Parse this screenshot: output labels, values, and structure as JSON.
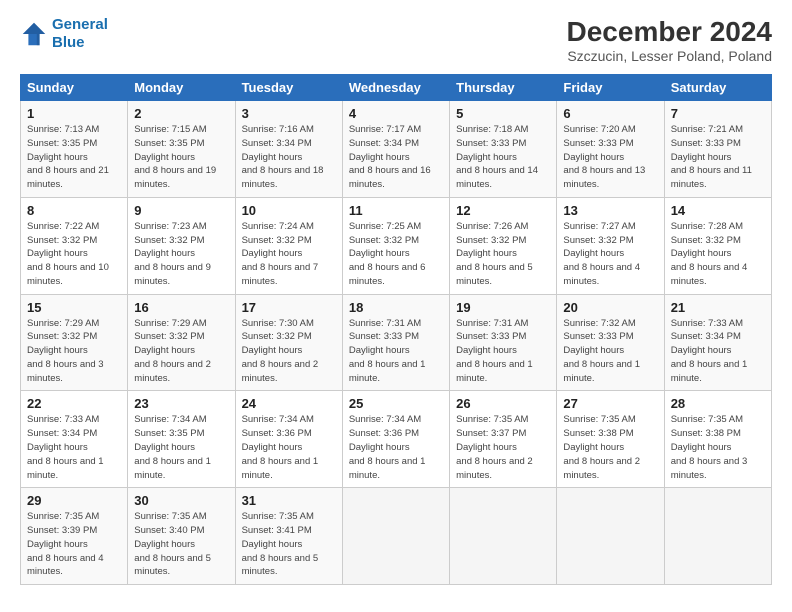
{
  "header": {
    "logo_line1": "General",
    "logo_line2": "Blue",
    "title": "December 2024",
    "subtitle": "Szczucin, Lesser Poland, Poland"
  },
  "calendar": {
    "days_of_week": [
      "Sunday",
      "Monday",
      "Tuesday",
      "Wednesday",
      "Thursday",
      "Friday",
      "Saturday"
    ],
    "weeks": [
      [
        {
          "day": 1,
          "sunrise": "7:13 AM",
          "sunset": "3:35 PM",
          "daylight": "8 hours and 21 minutes."
        },
        {
          "day": 2,
          "sunrise": "7:15 AM",
          "sunset": "3:35 PM",
          "daylight": "8 hours and 19 minutes."
        },
        {
          "day": 3,
          "sunrise": "7:16 AM",
          "sunset": "3:34 PM",
          "daylight": "8 hours and 18 minutes."
        },
        {
          "day": 4,
          "sunrise": "7:17 AM",
          "sunset": "3:34 PM",
          "daylight": "8 hours and 16 minutes."
        },
        {
          "day": 5,
          "sunrise": "7:18 AM",
          "sunset": "3:33 PM",
          "daylight": "8 hours and 14 minutes."
        },
        {
          "day": 6,
          "sunrise": "7:20 AM",
          "sunset": "3:33 PM",
          "daylight": "8 hours and 13 minutes."
        },
        {
          "day": 7,
          "sunrise": "7:21 AM",
          "sunset": "3:33 PM",
          "daylight": "8 hours and 11 minutes."
        }
      ],
      [
        {
          "day": 8,
          "sunrise": "7:22 AM",
          "sunset": "3:32 PM",
          "daylight": "8 hours and 10 minutes."
        },
        {
          "day": 9,
          "sunrise": "7:23 AM",
          "sunset": "3:32 PM",
          "daylight": "8 hours and 9 minutes."
        },
        {
          "day": 10,
          "sunrise": "7:24 AM",
          "sunset": "3:32 PM",
          "daylight": "8 hours and 7 minutes."
        },
        {
          "day": 11,
          "sunrise": "7:25 AM",
          "sunset": "3:32 PM",
          "daylight": "8 hours and 6 minutes."
        },
        {
          "day": 12,
          "sunrise": "7:26 AM",
          "sunset": "3:32 PM",
          "daylight": "8 hours and 5 minutes."
        },
        {
          "day": 13,
          "sunrise": "7:27 AM",
          "sunset": "3:32 PM",
          "daylight": "8 hours and 4 minutes."
        },
        {
          "day": 14,
          "sunrise": "7:28 AM",
          "sunset": "3:32 PM",
          "daylight": "8 hours and 4 minutes."
        }
      ],
      [
        {
          "day": 15,
          "sunrise": "7:29 AM",
          "sunset": "3:32 PM",
          "daylight": "8 hours and 3 minutes."
        },
        {
          "day": 16,
          "sunrise": "7:29 AM",
          "sunset": "3:32 PM",
          "daylight": "8 hours and 2 minutes."
        },
        {
          "day": 17,
          "sunrise": "7:30 AM",
          "sunset": "3:32 PM",
          "daylight": "8 hours and 2 minutes."
        },
        {
          "day": 18,
          "sunrise": "7:31 AM",
          "sunset": "3:33 PM",
          "daylight": "8 hours and 1 minute."
        },
        {
          "day": 19,
          "sunrise": "7:31 AM",
          "sunset": "3:33 PM",
          "daylight": "8 hours and 1 minute."
        },
        {
          "day": 20,
          "sunrise": "7:32 AM",
          "sunset": "3:33 PM",
          "daylight": "8 hours and 1 minute."
        },
        {
          "day": 21,
          "sunrise": "7:33 AM",
          "sunset": "3:34 PM",
          "daylight": "8 hours and 1 minute."
        }
      ],
      [
        {
          "day": 22,
          "sunrise": "7:33 AM",
          "sunset": "3:34 PM",
          "daylight": "8 hours and 1 minute."
        },
        {
          "day": 23,
          "sunrise": "7:34 AM",
          "sunset": "3:35 PM",
          "daylight": "8 hours and 1 minute."
        },
        {
          "day": 24,
          "sunrise": "7:34 AM",
          "sunset": "3:36 PM",
          "daylight": "8 hours and 1 minute."
        },
        {
          "day": 25,
          "sunrise": "7:34 AM",
          "sunset": "3:36 PM",
          "daylight": "8 hours and 1 minute."
        },
        {
          "day": 26,
          "sunrise": "7:35 AM",
          "sunset": "3:37 PM",
          "daylight": "8 hours and 2 minutes."
        },
        {
          "day": 27,
          "sunrise": "7:35 AM",
          "sunset": "3:38 PM",
          "daylight": "8 hours and 2 minutes."
        },
        {
          "day": 28,
          "sunrise": "7:35 AM",
          "sunset": "3:38 PM",
          "daylight": "8 hours and 3 minutes."
        }
      ],
      [
        {
          "day": 29,
          "sunrise": "7:35 AM",
          "sunset": "3:39 PM",
          "daylight": "8 hours and 4 minutes."
        },
        {
          "day": 30,
          "sunrise": "7:35 AM",
          "sunset": "3:40 PM",
          "daylight": "8 hours and 5 minutes."
        },
        {
          "day": 31,
          "sunrise": "7:35 AM",
          "sunset": "3:41 PM",
          "daylight": "8 hours and 5 minutes."
        },
        null,
        null,
        null,
        null
      ]
    ]
  }
}
